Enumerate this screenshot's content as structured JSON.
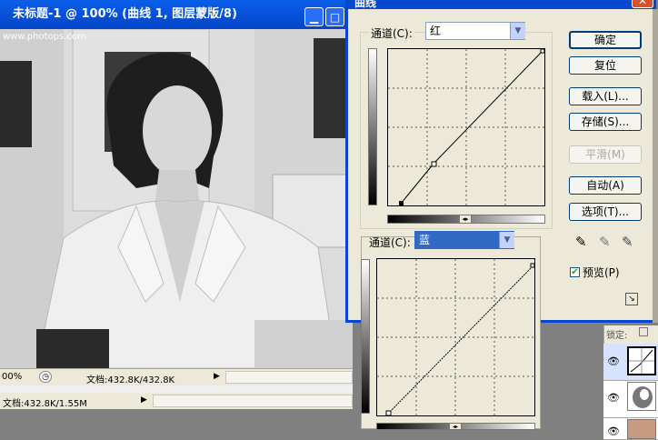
{
  "document": {
    "title": "未标题-1 @ 100% (曲线 1, 图层蒙版/8)",
    "watermark": "www.photops.com",
    "zoom": "00%",
    "doc_info": "文档:432.8K/432.8K",
    "app_status": "文档:432.8K/1.55M"
  },
  "curves_dialog": {
    "title": "曲线",
    "channel_label": "通道(C):",
    "channel_value": "红",
    "buttons": {
      "ok": "确定",
      "reset": "复位",
      "load": "载入(L)...",
      "save": "存储(S)...",
      "smooth": "平滑(M)",
      "auto": "自动(A)",
      "options": "选项(T)..."
    },
    "preview_label": "预览(P)",
    "preview_checked": true
  },
  "curves_dialog2": {
    "channel_label": "通道(C):",
    "channel_value": "蓝"
  },
  "layers": {
    "lock_label": "锁定:"
  },
  "colors": {
    "titlebar": "#0548d0",
    "dialog_bg": "#ece9d8"
  }
}
